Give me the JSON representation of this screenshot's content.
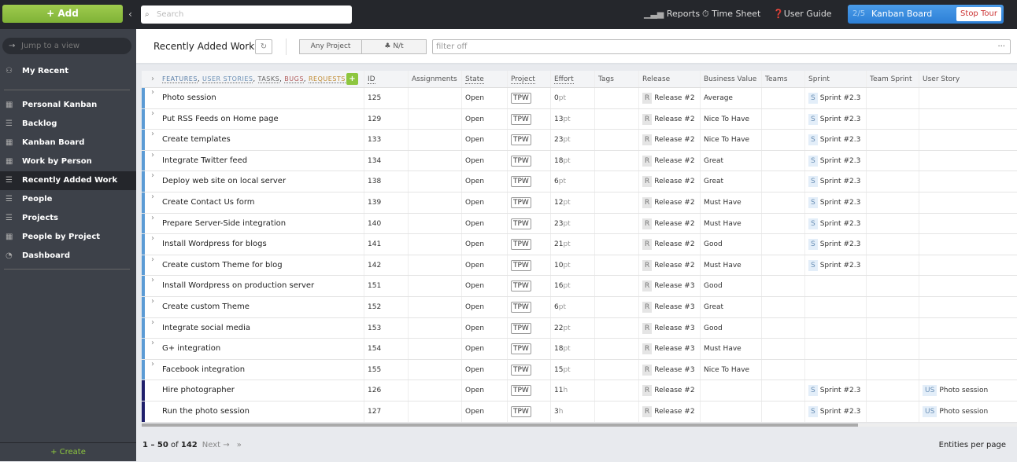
{
  "topbar": {
    "add_label": "+ Add",
    "search_placeholder": "Search",
    "reports": "Reports",
    "time_sheet": "Time Sheet",
    "user_guide": "User Guide",
    "tour_step": "2/5",
    "tour_title": "Kanban Board",
    "stop_tour": "Stop Tour"
  },
  "sidebar": {
    "jump_placeholder": "Jump to a view",
    "my_recent": "My Recent",
    "items": [
      {
        "label": "Personal Kanban",
        "icon": "board-icon"
      },
      {
        "label": "Backlog",
        "icon": "list-icon"
      },
      {
        "label": "Kanban Board",
        "icon": "board-icon"
      },
      {
        "label": "Work by Person",
        "icon": "board-icon"
      },
      {
        "label": "Recently Added Work",
        "icon": "list-icon",
        "active": true
      },
      {
        "label": "People",
        "icon": "list-icon"
      },
      {
        "label": "Projects",
        "icon": "list-icon"
      },
      {
        "label": "People by Project",
        "icon": "board-icon"
      },
      {
        "label": "Dashboard",
        "icon": "dashboard-icon"
      }
    ],
    "create": "+ Create"
  },
  "header": {
    "title": "Recently Added Work",
    "any_project": "Any Project",
    "team": "N/t",
    "filter_placeholder": "filter off"
  },
  "grid": {
    "entity_types": [
      "FEATURES",
      "USER STORIES",
      "TASKS",
      "BUGS",
      "REQUESTS"
    ],
    "columns": [
      "ID",
      "Assignments",
      "State",
      "Project",
      "Effort",
      "Tags",
      "Release",
      "Business Value",
      "Teams",
      "Sprint",
      "Team Sprint",
      "User Story"
    ],
    "rows": [
      {
        "name": "Photo session",
        "id": "125",
        "state": "Open",
        "project": "TPW",
        "effort": "0",
        "unit": "pt",
        "release": "Release #2",
        "bv": "Average",
        "sprint": "Sprint #2.3",
        "story": "",
        "type": "feature"
      },
      {
        "name": "Put RSS Feeds on Home page",
        "id": "129",
        "state": "Open",
        "project": "TPW",
        "effort": "13",
        "unit": "pt",
        "release": "Release #2",
        "bv": "Nice To Have",
        "sprint": "Sprint #2.3",
        "story": "",
        "type": "feature"
      },
      {
        "name": "Create templates",
        "id": "133",
        "state": "Open",
        "project": "TPW",
        "effort": "23",
        "unit": "pt",
        "release": "Release #2",
        "bv": "Nice To Have",
        "sprint": "Sprint #2.3",
        "story": "",
        "type": "feature"
      },
      {
        "name": "Integrate Twitter feed",
        "id": "134",
        "state": "Open",
        "project": "TPW",
        "effort": "18",
        "unit": "pt",
        "release": "Release #2",
        "bv": "Great",
        "sprint": "Sprint #2.3",
        "story": "",
        "type": "feature"
      },
      {
        "name": "Deploy web site on local server",
        "id": "138",
        "state": "Open",
        "project": "TPW",
        "effort": "6",
        "unit": "pt",
        "release": "Release #2",
        "bv": "Great",
        "sprint": "Sprint #2.3",
        "story": "",
        "type": "feature"
      },
      {
        "name": "Create Contact Us form",
        "id": "139",
        "state": "Open",
        "project": "TPW",
        "effort": "12",
        "unit": "pt",
        "release": "Release #2",
        "bv": "Must Have",
        "sprint": "Sprint #2.3",
        "story": "",
        "type": "feature"
      },
      {
        "name": "Prepare Server-Side integration",
        "id": "140",
        "state": "Open",
        "project": "TPW",
        "effort": "23",
        "unit": "pt",
        "release": "Release #2",
        "bv": "Must Have",
        "sprint": "Sprint #2.3",
        "story": "",
        "type": "feature"
      },
      {
        "name": "Install Wordpress for blogs",
        "id": "141",
        "state": "Open",
        "project": "TPW",
        "effort": "21",
        "unit": "pt",
        "release": "Release #2",
        "bv": "Good",
        "sprint": "Sprint #2.3",
        "story": "",
        "type": "feature"
      },
      {
        "name": "Create custom Theme for blog",
        "id": "142",
        "state": "Open",
        "project": "TPW",
        "effort": "10",
        "unit": "pt",
        "release": "Release #2",
        "bv": "Must Have",
        "sprint": "Sprint #2.3",
        "story": "",
        "type": "feature"
      },
      {
        "name": "Install Wordpress on production server",
        "id": "151",
        "state": "Open",
        "project": "TPW",
        "effort": "16",
        "unit": "pt",
        "release": "Release #3",
        "bv": "Good",
        "sprint": "",
        "story": "",
        "type": "feature"
      },
      {
        "name": "Create custom Theme",
        "id": "152",
        "state": "Open",
        "project": "TPW",
        "effort": "6",
        "unit": "pt",
        "release": "Release #3",
        "bv": "Great",
        "sprint": "",
        "story": "",
        "type": "feature"
      },
      {
        "name": "Integrate social media",
        "id": "153",
        "state": "Open",
        "project": "TPW",
        "effort": "22",
        "unit": "pt",
        "release": "Release #3",
        "bv": "Good",
        "sprint": "",
        "story": "",
        "type": "feature"
      },
      {
        "name": "G+ integration",
        "id": "154",
        "state": "Open",
        "project": "TPW",
        "effort": "18",
        "unit": "pt",
        "release": "Release #3",
        "bv": "Must Have",
        "sprint": "",
        "story": "",
        "type": "feature"
      },
      {
        "name": "Facebook integration",
        "id": "155",
        "state": "Open",
        "project": "TPW",
        "effort": "15",
        "unit": "pt",
        "release": "Release #3",
        "bv": "Nice To Have",
        "sprint": "",
        "story": "",
        "type": "feature"
      },
      {
        "name": "Hire photographer",
        "id": "126",
        "state": "Open",
        "project": "TPW",
        "effort": "11",
        "unit": "h",
        "release": "Release #2",
        "bv": "",
        "sprint": "Sprint #2.3",
        "story": "Photo session",
        "type": "task"
      },
      {
        "name": "Run the photo session",
        "id": "127",
        "state": "Open",
        "project": "TPW",
        "effort": "3",
        "unit": "h",
        "release": "Release #2",
        "bv": "",
        "sprint": "Sprint #2.3",
        "story": "Photo session",
        "type": "task"
      }
    ]
  },
  "badges": {
    "release": "R",
    "sprint": "S",
    "story": "US"
  },
  "footer": {
    "range": "1 – 50",
    "of": "of",
    "total": "142",
    "next": "Next →",
    "last": "»",
    "entities_per_page": "Entities per page"
  },
  "colors": {
    "feature": "#5b9bd5",
    "task": "#1f1f6b",
    "add": "#8dc63f",
    "tour": "#3a8de0"
  }
}
